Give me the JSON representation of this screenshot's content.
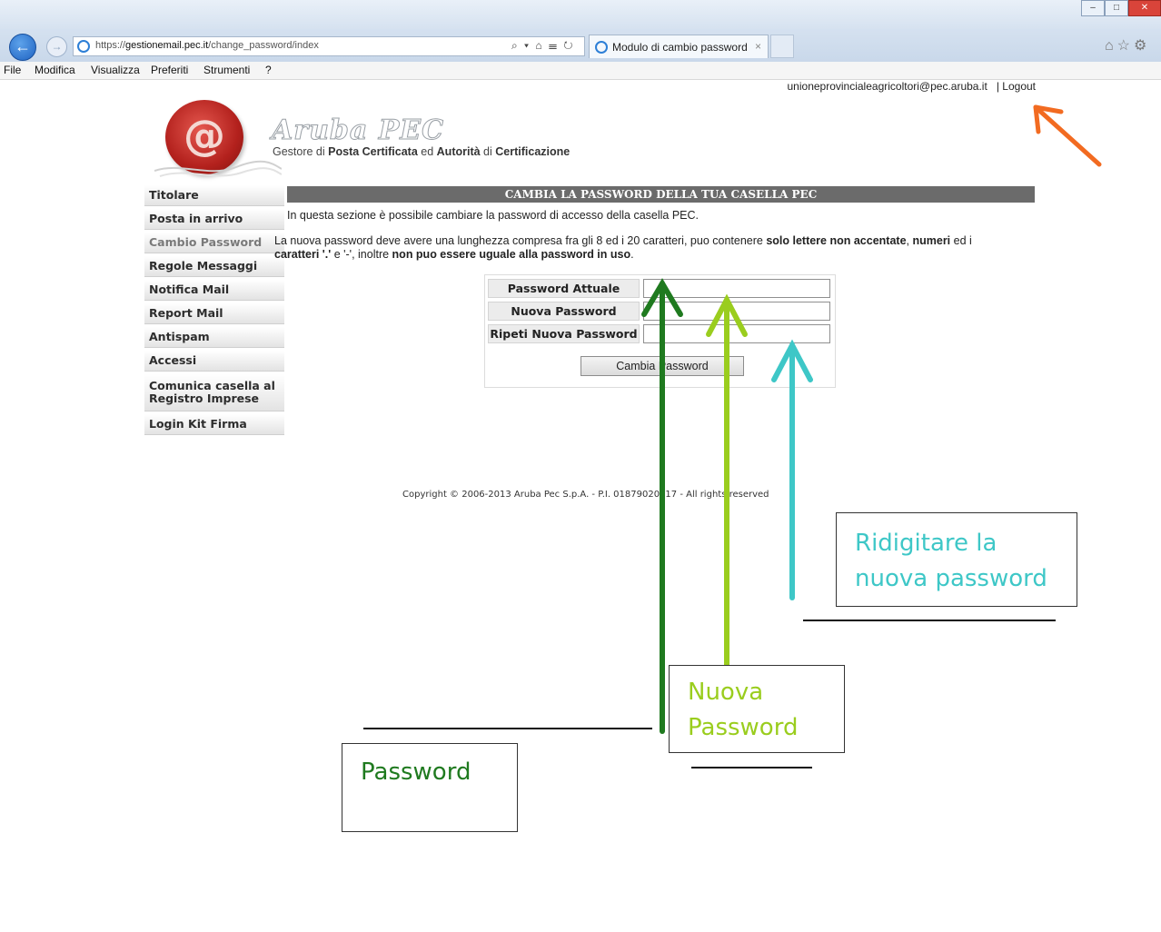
{
  "browser": {
    "url_prefix": "https://",
    "url_host": "gestionemail.pec.it",
    "url_path": "/change_password/index",
    "address_tools": "⌕ ▾ ⌂ ☰ ↻",
    "tab_title": "Modulo di cambio password",
    "tab_close": "×",
    "menu": [
      "File",
      "Modifica",
      "Visualizza",
      "Preferiti",
      "Strumenti",
      "?"
    ],
    "right_tools": "⌂☆⚙",
    "window_buttons": [
      "–",
      "□",
      "✕"
    ]
  },
  "header": {
    "user_email": "unioneprovincialeagricoltori@pec.aruba.it",
    "separator": "|",
    "logout_label": "Logout",
    "brand_name": "Aruba PEC",
    "logo_symbol": "@",
    "subtitle": {
      "p1": "Gestore di ",
      "b1": "Posta Certificata",
      "p2": " ed ",
      "b2": "Autorità",
      "p3": " di ",
      "b3": "Certificazione"
    }
  },
  "sidebar": {
    "items": [
      {
        "label": "Titolare"
      },
      {
        "label": "Posta in arrivo"
      },
      {
        "label": "Cambio Password"
      },
      {
        "label": "Regole Messaggi"
      },
      {
        "label": "Notifica Mail"
      },
      {
        "label": "Report Mail"
      },
      {
        "label": "Antispam"
      },
      {
        "label": "Accessi"
      },
      {
        "label_line1": "Comunica casella al",
        "label_line2": "Registro Imprese"
      },
      {
        "label": "Login Kit Firma"
      }
    ]
  },
  "main": {
    "section_title": "CAMBIA LA PASSWORD DELLA TUA CASELLA PEC",
    "intro": "In questa sezione è possibile cambiare la password di accesso della casella PEC.",
    "rules": {
      "t1": "La nuova password deve avere una lunghezza compresa fra gli 8 ed i 20 caratteri, puo contenere ",
      "b1": "solo lettere non accentate",
      "t2": ", ",
      "b2": "numeri",
      "t3": " ed i ",
      "b3": "caratteri '.'",
      "t4": " e '-', inoltre ",
      "b4": "non puo essere uguale alla password in uso",
      "t5": "."
    },
    "form": {
      "current_label": "Password Attuale",
      "new_label": "Nuova Password",
      "repeat_label": "Ripeti Nuova Password",
      "current_value": "",
      "new_value": "",
      "repeat_value": "",
      "submit_label": "Cambia Password"
    },
    "copyright": "Copyright © 2006-2013 Aruba Pec S.p.A. - P.I. 01879020517 - All rights reserved"
  },
  "annotations": {
    "box_password": "Password",
    "box_new_line1": "Nuova",
    "box_new_line2": "Password",
    "box_repeat_line1": "Ridigitare la",
    "box_repeat_line2": "nuova password",
    "colors": {
      "dark_green": "#1f7a1f",
      "light_green": "#9acd1e",
      "cyan": "#3ec7c7",
      "orange": "#f26b21"
    }
  }
}
